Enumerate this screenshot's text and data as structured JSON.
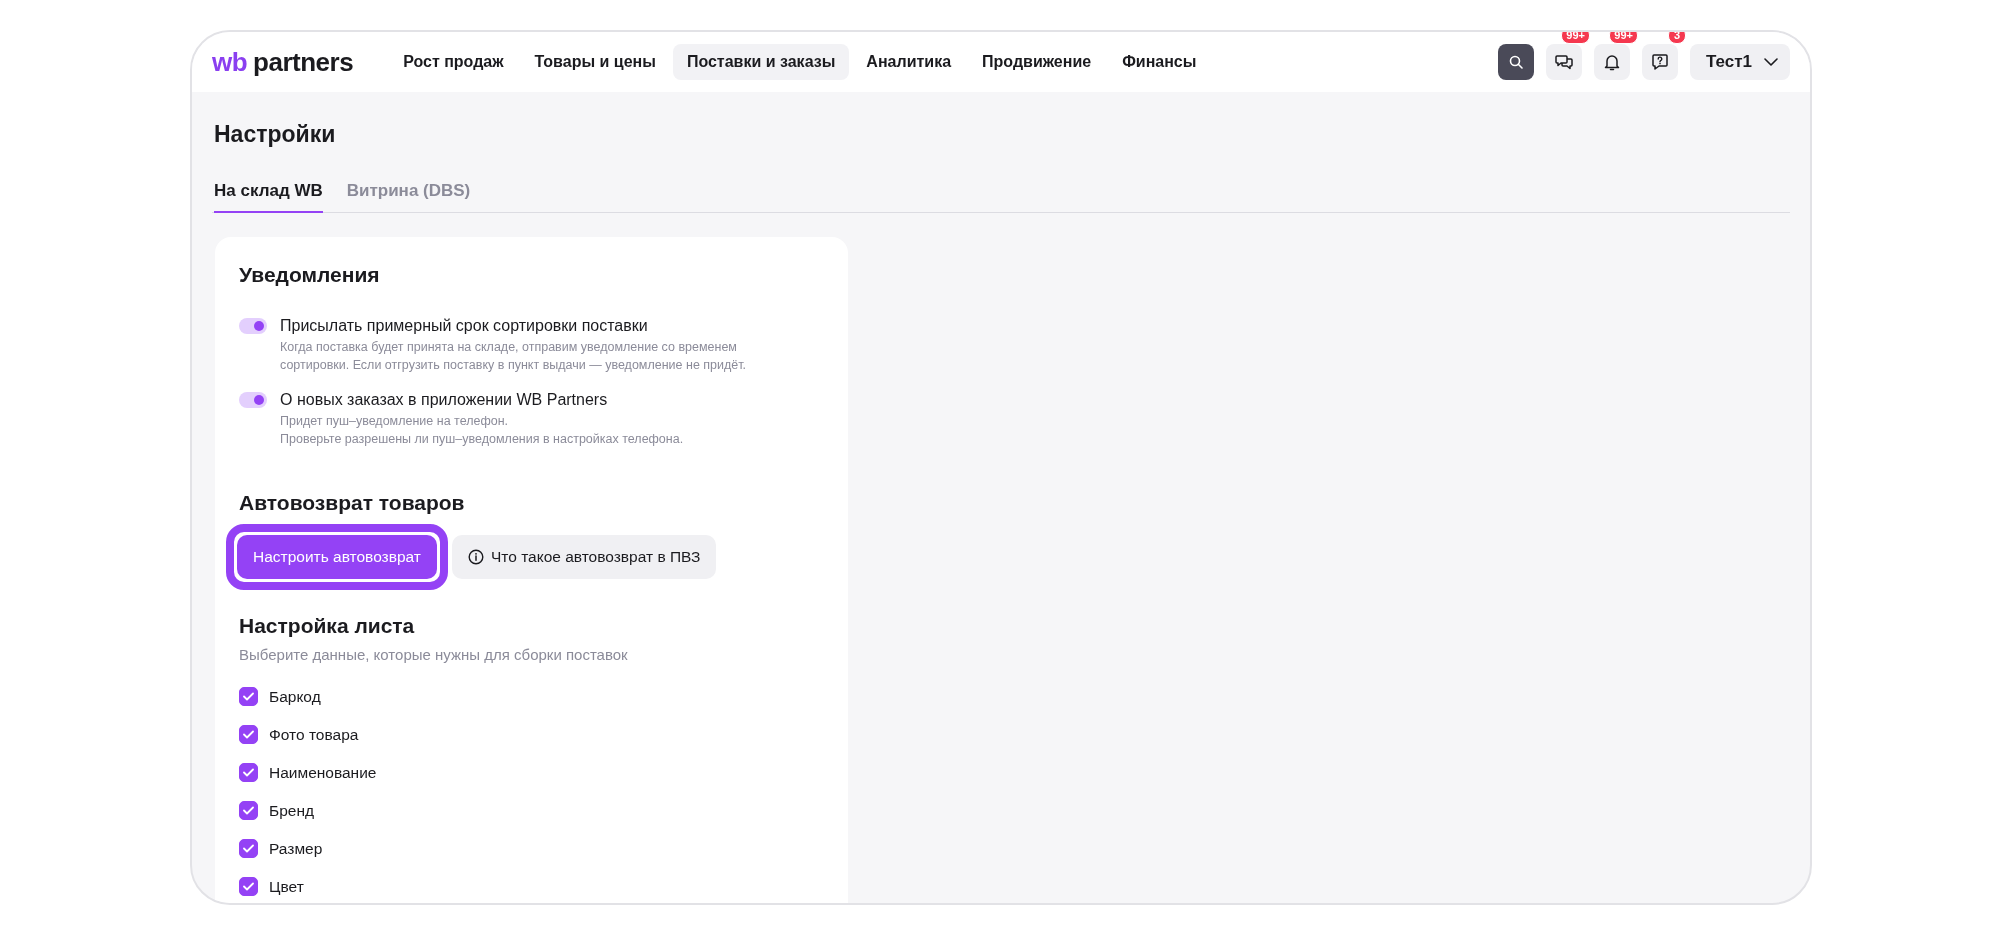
{
  "logo": {
    "brand": "wb",
    "name": "partners"
  },
  "nav": [
    {
      "label": "Рост продаж",
      "selected": false
    },
    {
      "label": "Товары и цены",
      "selected": false
    },
    {
      "label": "Поставки и заказы",
      "selected": true
    },
    {
      "label": "Аналитика",
      "selected": false
    },
    {
      "label": "Продвижение",
      "selected": false
    },
    {
      "label": "Финансы",
      "selected": false
    }
  ],
  "header_actions": [
    {
      "kind": "search"
    },
    {
      "kind": "chat",
      "badge": "99+"
    },
    {
      "kind": "bell",
      "badge": "99+"
    },
    {
      "kind": "help",
      "badge": "3"
    }
  ],
  "user_menu": {
    "label": "Тест1"
  },
  "page_title": "Настройки",
  "tabs": [
    {
      "label": "На склад WB",
      "selected": true
    },
    {
      "label": "Витрина (DBS)",
      "selected": false
    }
  ],
  "notifications": {
    "title": "Уведомления",
    "items": [
      {
        "label": "Присылать примерный срок сортировки поставки",
        "description": [
          "Когда поставка будет принята на складе, отправим уведомление со временем",
          "сортировки. Если отгрузить поставку в пункт выдачи — уведомление не придёт."
        ],
        "on": true
      },
      {
        "label": "О новых заказах в приложении WB Partners",
        "description": [
          "Придет пуш–уведомление на телефон.",
          "Проверьте разрешены ли пуш–уведомления в настройках телефона."
        ],
        "on": true
      }
    ]
  },
  "autoreturn": {
    "title": "Автовозврат товаров",
    "primary_button": {
      "label": "Настроить автовозврат",
      "highlighted": true
    },
    "info_button": {
      "label": "Что такое автовозврат в ПВЗ"
    }
  },
  "sheet": {
    "title": "Настройка листа",
    "subtitle": "Выберите данные, которые нужны для сборки поставок",
    "fields": [
      {
        "label": "Баркод",
        "checked": true
      },
      {
        "label": "Фото товара",
        "checked": true
      },
      {
        "label": "Наименование",
        "checked": true
      },
      {
        "label": "Бренд",
        "checked": true
      },
      {
        "label": "Размер",
        "checked": true
      },
      {
        "label": "Цвет",
        "checked": true
      }
    ]
  }
}
